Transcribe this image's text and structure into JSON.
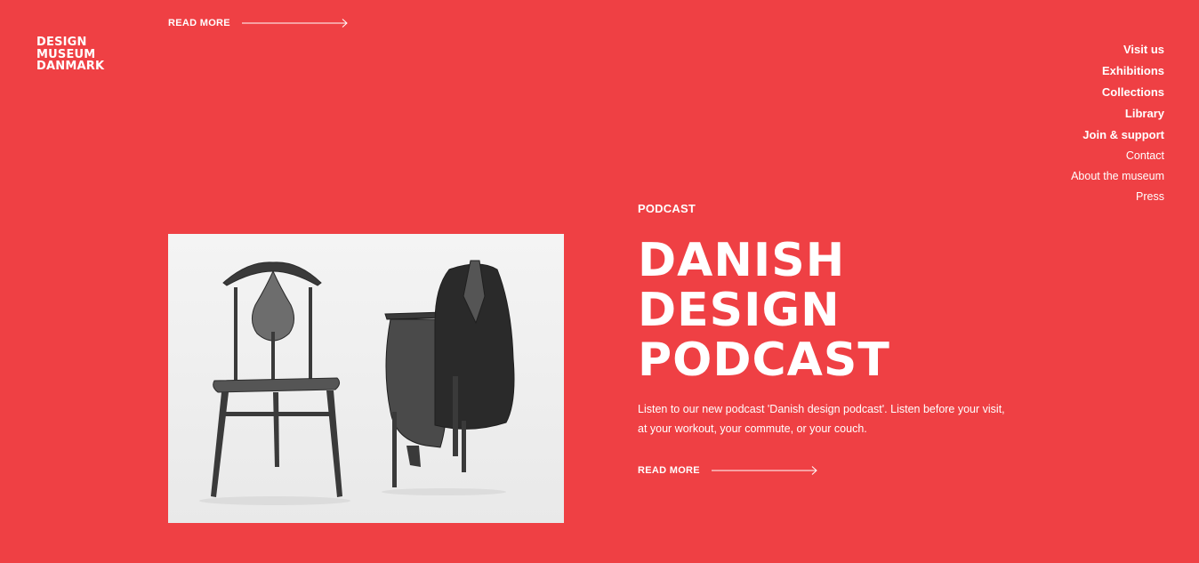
{
  "logo": {
    "line1": "DESIGN",
    "line2": "MUSEUM",
    "line3": "DANMARK"
  },
  "top_link": {
    "label": "READ MORE",
    "icon": "arrow-right-icon"
  },
  "nav": {
    "primary": [
      "Visit us",
      "Exhibitions",
      "Collections",
      "Library",
      "Join & support"
    ],
    "secondary": [
      "Contact",
      "About the museum",
      "Press"
    ]
  },
  "feature": {
    "kicker": "PODCAST",
    "headline_lines": [
      "DANISH",
      "DESIGN",
      "PODCAST"
    ],
    "description": "Listen to our new podcast 'Danish design podcast'. Listen before your visit, at your workout, your commute, or your couch.",
    "link_label": "READ MORE",
    "link_icon": "arrow-right-icon"
  },
  "colors": {
    "background": "#ef4044",
    "text": "#ffffff",
    "image_background": "#f2f2f2"
  }
}
